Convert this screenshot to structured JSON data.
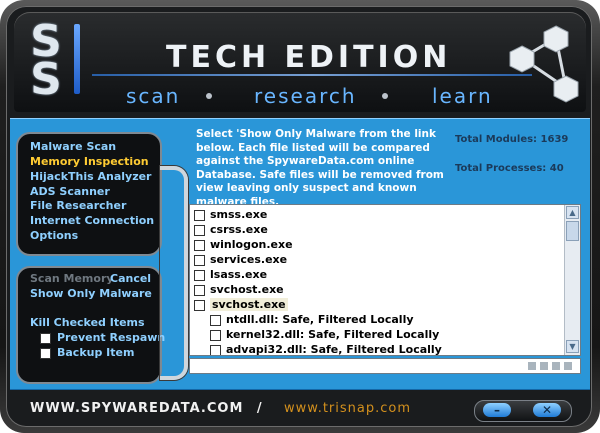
{
  "header": {
    "title": "TECH EDITION",
    "logo_letters": [
      "S",
      "S"
    ],
    "nav": [
      "scan",
      "research",
      "learn"
    ]
  },
  "sidebar": {
    "items": [
      {
        "label": "Malware Scan",
        "active": false
      },
      {
        "label": "Memory Inspection",
        "active": true
      },
      {
        "label": "HijackThis  Analyzer",
        "active": false
      },
      {
        "label": "ADS Scanner",
        "active": false
      },
      {
        "label": "File Researcher",
        "active": false
      },
      {
        "label": "Internet Connection",
        "active": false
      },
      {
        "label": "Options",
        "active": false
      }
    ]
  },
  "actions": {
    "scan_memory": "Scan Memory",
    "cancel": "Cancel",
    "show_only_malware": "Show Only Malware",
    "kill_checked": "Kill Checked Items",
    "prevent_respawn": "Prevent Respawn",
    "backup_item": "Backup Item"
  },
  "main": {
    "description": "Select 'Show Only Malware from the link below. Each file listed will be compared against the SpywareData.com online Database. Safe files will be removed from view leaving only suspect and known malware files.",
    "total_modules": "Total Modules: 1639",
    "total_processes": "Total Processes: 40"
  },
  "list": {
    "items": [
      {
        "label": "smss.exe",
        "indent": 0,
        "selected": false
      },
      {
        "label": "csrss.exe",
        "indent": 0,
        "selected": false
      },
      {
        "label": "winlogon.exe",
        "indent": 0,
        "selected": false
      },
      {
        "label": "services.exe",
        "indent": 0,
        "selected": false
      },
      {
        "label": "lsass.exe",
        "indent": 0,
        "selected": false
      },
      {
        "label": "svchost.exe",
        "indent": 0,
        "selected": false
      },
      {
        "label": "svchost.exe",
        "indent": 0,
        "selected": true
      },
      {
        "label": "ntdll.dll:  Safe, Filtered Locally",
        "indent": 1,
        "selected": false
      },
      {
        "label": "kernel32.dll:  Safe, Filtered Locally",
        "indent": 1,
        "selected": false
      },
      {
        "label": "advapi32.dll:  Safe, Filtered Locally",
        "indent": 1,
        "selected": false
      }
    ]
  },
  "footer": {
    "left": "WWW.SPYWAREDATA.COM",
    "separator": "/",
    "right": "www.trisnap.com",
    "minimize": "–",
    "close": "✕"
  },
  "colors": {
    "accent_blue": "#2a96d8",
    "menu_text": "#8fd0ff",
    "active_text": "#ffcc33",
    "footer_right": "#d3901d"
  },
  "icons": [
    "molecule-icon",
    "checkbox-icon",
    "scroll-up-icon",
    "scroll-down-icon",
    "minimize-icon",
    "close-icon"
  ]
}
